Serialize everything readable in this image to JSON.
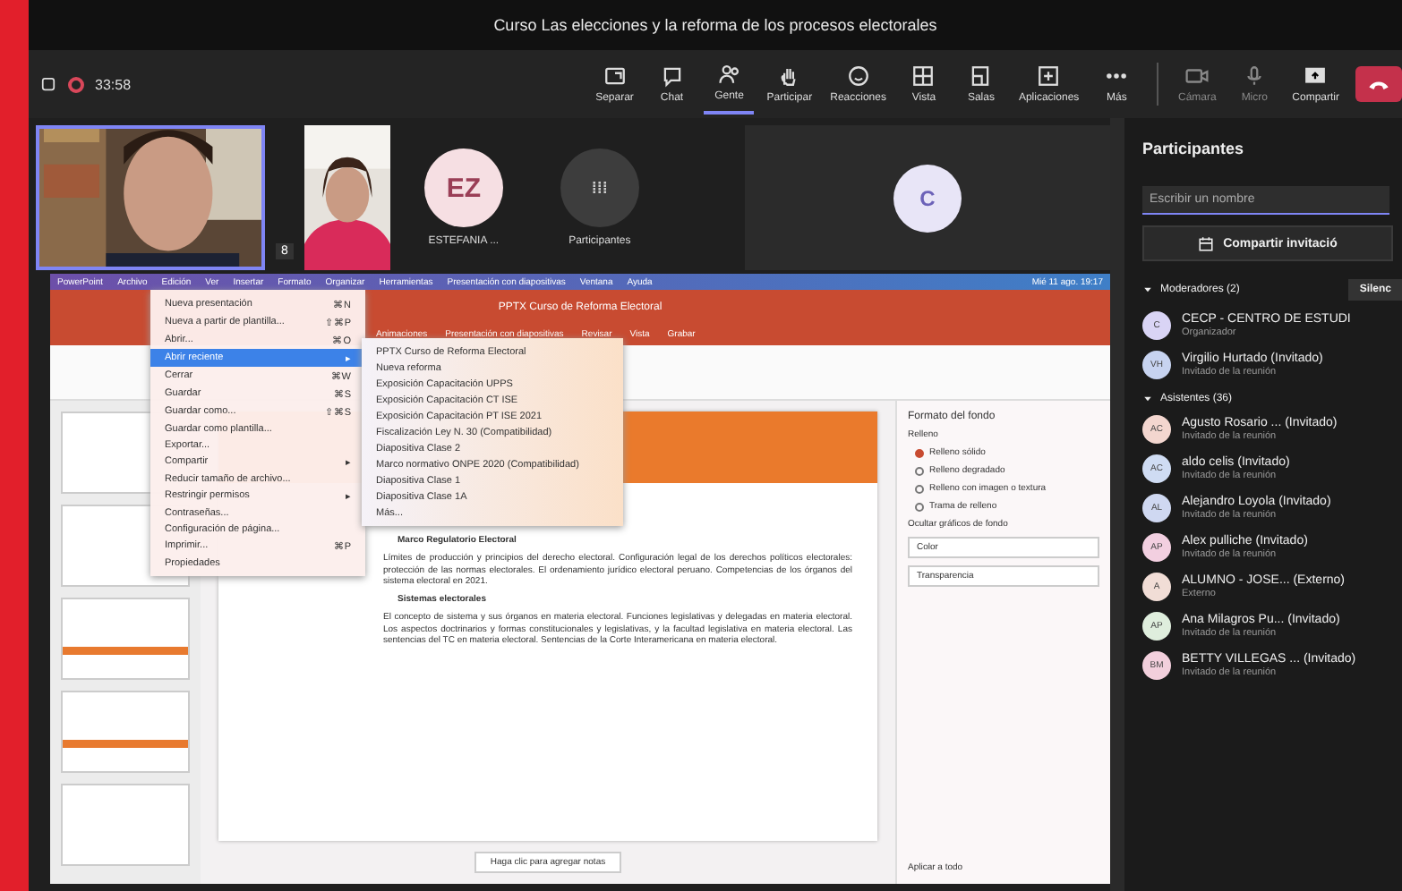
{
  "window": {
    "title": "Curso Las elecciones y la reforma de los procesos electorales"
  },
  "meeting_bar": {
    "timer": "33:58",
    "tools": [
      {
        "kind": "popout",
        "label": "Separar",
        "selected": false
      },
      {
        "kind": "chat",
        "label": "Chat",
        "selected": false
      },
      {
        "kind": "people",
        "label": "Gente",
        "selected": true
      },
      {
        "kind": "hand",
        "label": "Participar",
        "selected": false
      },
      {
        "kind": "smile",
        "label": "Reacciones",
        "selected": false
      },
      {
        "kind": "grid",
        "label": "Vista",
        "selected": false
      },
      {
        "kind": "rooms",
        "label": "Salas",
        "selected": false
      },
      {
        "kind": "apps",
        "label": "Aplicaciones",
        "selected": false
      },
      {
        "kind": "more",
        "label": "Más",
        "selected": false
      }
    ],
    "call_tools": [
      {
        "kind": "camera",
        "label": "Cámara",
        "disabled": true
      },
      {
        "kind": "mic",
        "label": "Micro",
        "disabled": true
      },
      {
        "kind": "share",
        "label": "Compartir",
        "disabled": false
      }
    ]
  },
  "videos": [
    {
      "kind": "picture",
      "speaking": true
    },
    {
      "kind": "badge",
      "initials": "8"
    },
    {
      "kind": "picture",
      "speaking": false
    },
    {
      "kind": "avatar",
      "initials": "EZ",
      "name": "ESTEFANIA ..."
    },
    {
      "kind": "overflow",
      "initials": "⁞⁞⁞",
      "name": "Participantes"
    },
    {
      "kind": "large",
      "initials": "C"
    }
  ],
  "shared_screen": {
    "menu_bar": [
      "PowerPoint",
      "Archivo",
      "Edición",
      "Ver",
      "Insertar",
      "Formato",
      "Organizar",
      "Herramientas",
      "Presentación con diapositivas",
      "Ventana",
      "Ayuda"
    ],
    "status": "Mié 11 ago. 19:17",
    "doc_title": "PPTX Curso de Reforma Electoral",
    "ribbon_tabs": [
      "Animaciones",
      "Presentación con diapositivas",
      "Revisar",
      "Vista",
      "Grabar"
    ],
    "file_menu": [
      {
        "label": "Nueva presentación",
        "shortcut": "⌘N",
        "selected": false
      },
      {
        "label": "Nueva a partir de plantilla...",
        "shortcut": "⇧⌘P",
        "selected": false
      },
      {
        "label": "Abrir...",
        "shortcut": "⌘O",
        "selected": false
      },
      {
        "label": "Abrir reciente",
        "shortcut": "▸",
        "selected": true
      },
      {
        "label": "Cerrar",
        "shortcut": "⌘W",
        "selected": false
      },
      {
        "label": "Guardar",
        "shortcut": "⌘S",
        "selected": false
      },
      {
        "label": "Guardar como...",
        "shortcut": "⇧⌘S",
        "selected": false
      },
      {
        "label": "Guardar como plantilla...",
        "selected": false
      },
      {
        "label": "Exportar...",
        "selected": false
      },
      {
        "label": "Compartir",
        "shortcut": "▸",
        "selected": false
      },
      {
        "label": "Reducir tamaño de archivo...",
        "selected": false
      },
      {
        "label": "Restringir permisos",
        "shortcut": "▸",
        "selected": false
      },
      {
        "label": "Contraseñas...",
        "selected": false
      },
      {
        "label": "Configuración de página...",
        "selected": false
      },
      {
        "label": "Imprimir...",
        "shortcut": "⌘P",
        "selected": false
      },
      {
        "label": "Propiedades",
        "selected": false
      }
    ],
    "recent": [
      "PPTX Curso de Reforma Electoral",
      "Nueva reforma",
      "Exposición Capacitación UPPS",
      "Exposición Capacitación CT ISE",
      "Exposición Capacitación PT ISE 2021",
      "Fiscalización Ley N. 30 (Compatibilidad)",
      "Diapositiva Clase 2",
      "Marco normativo ONPE 2020 (Compatibilidad)",
      "Diapositiva Clase 1",
      "Diapositiva Clase 1A",
      "Más..."
    ],
    "slide": {
      "heading": "Marco Regulatorio Electoral",
      "paragraph": "Límites de producción y principios del derecho electoral. Configuración legal de los derechos políticos electorales: protección de las normas electorales. El ordenamiento jurídico electoral peruano. Competencias de los órganos del sistema electoral en 2021.",
      "bullet": "Sistemas electorales",
      "paragraph2": "El concepto de sistema y sus órganos en materia electoral. Funciones legislativas y delegadas en materia electoral. Los aspectos doctrinarios y formas constitucionales y legislativas, y la facultad legislativa en materia electoral. Las sentencias del TC en materia electoral. Sentencias de la Corte Interamericana en materia electoral."
    },
    "notes_placeholder": "Haga clic para agregar notas",
    "format_pane": {
      "title": "Formato del fondo",
      "section": "Relleno",
      "options": [
        {
          "label": "Relleno sólido",
          "selected": true
        },
        {
          "label": "Relleno degradado",
          "selected": false
        },
        {
          "label": "Relleno con imagen o textura",
          "selected": false
        },
        {
          "label": "Trama de relleno",
          "selected": false
        }
      ],
      "hide": "Ocultar gráficos de fondo",
      "color_label": "Color",
      "transparency_label": "Transparencia",
      "apply": "Aplicar a todo"
    }
  },
  "participants": {
    "title": "Participantes",
    "search": {
      "placeholder": "Escribir un nombre"
    },
    "invite": "Compartir invitació",
    "groups": [
      {
        "label": "Moderadores (2)",
        "expanded": true,
        "action": "Silenc",
        "people": [
          {
            "initials": "C",
            "name": "CECP - CENTRO DE ESTUDI",
            "role": "Organizador",
            "color": "#d9d4f5"
          },
          {
            "initials": "VH",
            "name": "Virgilio Hurtado (Invitado)",
            "role": "Invitado de la reunión",
            "color": "#c7d3f0"
          }
        ]
      },
      {
        "label": "Asistentes (36)",
        "expanded": true,
        "people": [
          {
            "initials": "AC",
            "name": "Agusto Rosario ... (Invitado)",
            "role": "Invitado de la reunión",
            "color": "#f3d6cf"
          },
          {
            "initials": "AC",
            "name": "aldo celis (Invitado)",
            "role": "Invitado de la reunión",
            "color": "#cfdcf3"
          },
          {
            "initials": "AL",
            "name": "Alejandro Loyola (Invitado)",
            "role": "Invitado de la reunión",
            "color": "#cfd8f1"
          },
          {
            "initials": "AP",
            "name": "Alex pulliche (Invitado)",
            "role": "Invitado de la reunión",
            "color": "#f2cfe0"
          },
          {
            "initials": "A",
            "name": "ALUMNO - JOSE... (Externo)",
            "role": "Externo",
            "color": "#f1ddd6"
          },
          {
            "initials": "AP",
            "name": "Ana Milagros Pu... (Invitado)",
            "role": "Invitado de la reunión",
            "color": "#dfeedd"
          },
          {
            "initials": "BM",
            "name": "BETTY VILLEGAS ... (Invitado)",
            "role": "Invitado de la reunión",
            "color": "#f2cfdc"
          }
        ]
      }
    ]
  }
}
